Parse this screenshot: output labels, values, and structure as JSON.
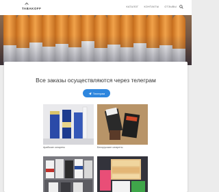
{
  "header": {
    "logo_text": "TABAKOFF",
    "nav": [
      "Каталог",
      "Контакты",
      "Отзывы"
    ]
  },
  "main": {
    "title": "Все заказы осуществляются через телеграм",
    "telegram_button": "Телеграм",
    "products": [
      {
        "label": "Арабские сигареты"
      },
      {
        "label": "Белорусские сигареты"
      },
      {
        "label": ""
      },
      {
        "label": ""
      }
    ]
  },
  "colors": {
    "accent": "#2e86de",
    "hero_filter": "#e0903a"
  },
  "icons": [
    "search-icon",
    "telegram-icon",
    "logo-mark-icon"
  ]
}
